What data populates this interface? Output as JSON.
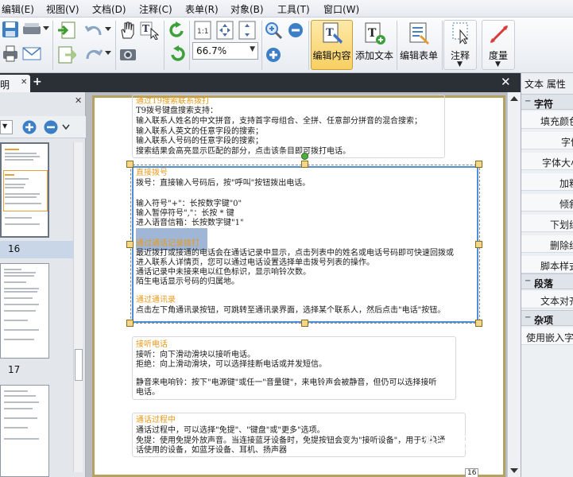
{
  "menu": [
    "编辑(E)",
    "视图(V)",
    "文档(D)",
    "注释(C)",
    "表单(R)",
    "对象(B)",
    "工具(T)",
    "窗口(W)"
  ],
  "toolbar": {
    "zoom_value": "66.7%",
    "edit_content_label": "编辑内容",
    "add_text_label": "添加文本",
    "edit_form_label": "编辑表单",
    "annotate_label": "注释",
    "measure_label": "度量"
  },
  "tab": {
    "doc_label": "明",
    "close_glyph": "✕",
    "new_glyph": "+",
    "close_doc_glyph": "✕"
  },
  "thumbnails": {
    "close_glyph": "✕",
    "labels": [
      "16",
      "17"
    ]
  },
  "document": {
    "page_number": "16",
    "block1": {
      "heading": "通过T9搜索联系拨打",
      "lines": [
        "T9拨号键盘搜索支持：",
        "输入联系人姓名的中文拼音，支持首字母组合、全拼、任意部分拼音的混合搜索；",
        "输入联系人英文的任意字段的搜索；",
        "输入联系人号码的任意字段的搜索；",
        "搜索结果会高亮显示匹配的部分，点击该条目即可拨打电话。"
      ]
    },
    "block2": {
      "heading": "直接拨号",
      "lines": [
        "拨号：直接输入号码后，按\"呼叫\"按钮拨出电话。",
        "",
        "输入符号\"+\"：长按数字键\"0\"",
        "输入暂停符号\",\"：长按 * 键",
        "进入语音信箱：长按数字键\"1\""
      ],
      "heading2": "通过通话记录拨打",
      "lines2": [
        "最近拨打或接通的电话会在通话记录中显示，点击列表中的姓名或电话号码即可快速回拨或",
        "进入联系人详情页，您可以通过电话设置选择单击拨号列表的操作。",
        "通话记录中未接来电以红色标识，显示响铃次数。",
        "陌生电话显示号码的归属地。"
      ],
      "heading3": "通过通讯录",
      "lines3": [
        "点击左下角通讯录按钮，可跳转至通讯录界面，选择某个联系人，然后点击\"电话\"按钮。"
      ]
    },
    "block3": {
      "heading": "接听电话",
      "lines": [
        "接听：向下滑动滑块以接听电话。",
        "拒绝：向上滑动滑块，可以选择挂断电话或并发短信。",
        "",
        "静音来电响铃：按下\"电源键\"或任一\"音量键\"，来电铃声会被静音，但仍可以选择接听",
        "电话。"
      ]
    },
    "block4": {
      "heading": "通话过程中",
      "lines": [
        "通话过程中，可以选择\"免提\"、\"键盘\"或\"更多\"选项。",
        "免提：使用免提外放声音。当连接蓝牙设备时，免提按钮会变为\"接听设备\"，用于切换通",
        "话使用的设备，如蓝牙设备、耳机、扬声器"
      ]
    },
    "watermark": "Bai 经验"
  },
  "properties": {
    "title": "文本 属性",
    "sections": [
      {
        "toggle": "−",
        "label": "字符"
      },
      {
        "toggle": "−",
        "label": "段落"
      },
      {
        "toggle": "−",
        "label": "杂项"
      }
    ],
    "char_rows": [
      "填充颜色",
      "字体",
      "字体大小",
      "加粗",
      "倾斜",
      "下划线",
      "删除线",
      "脚本样式"
    ],
    "para_rows": [
      "文本对齐"
    ],
    "misc_rows": [
      "使用嵌入字体"
    ]
  }
}
